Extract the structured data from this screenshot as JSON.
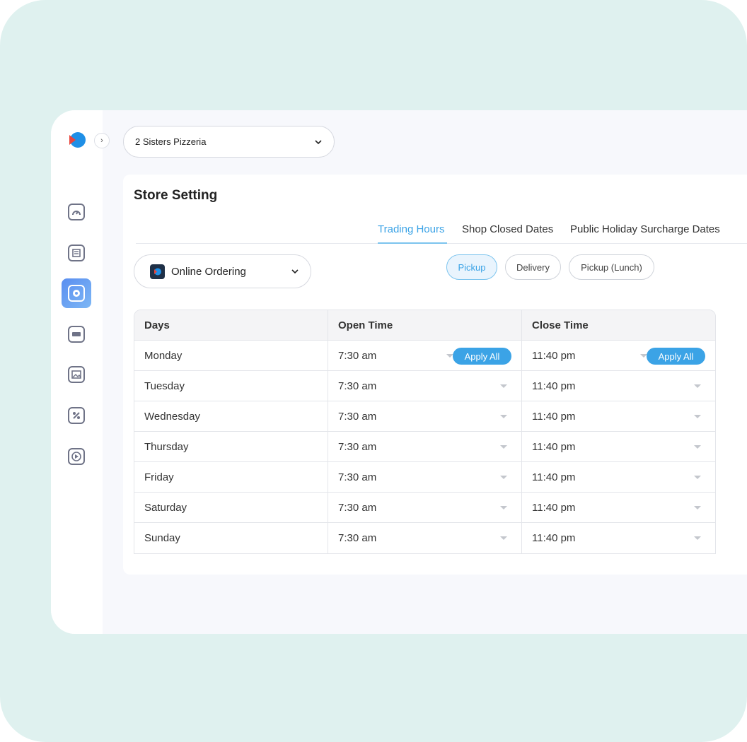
{
  "store_selector": {
    "value": "2 Sisters Pizzeria"
  },
  "page_title": "Store Setting",
  "tabs": [
    {
      "label": "Trading Hours",
      "active": true
    },
    {
      "label": "Shop Closed Dates",
      "active": false
    },
    {
      "label": "Public Holiday Surcharge Dates",
      "active": false
    }
  ],
  "channel_selector": {
    "value": "Online Ordering"
  },
  "order_types": [
    {
      "label": "Pickup",
      "active": true
    },
    {
      "label": "Delivery",
      "active": false
    },
    {
      "label": "Pickup (Lunch)",
      "active": false
    }
  ],
  "table": {
    "headers": [
      "Days",
      "Open Time",
      "Close Time"
    ],
    "apply_all_label": "Apply All",
    "rows": [
      {
        "day": "Monday",
        "open": "7:30 am",
        "close": "11:40 pm"
      },
      {
        "day": "Tuesday",
        "open": "7:30 am",
        "close": "11:40 pm"
      },
      {
        "day": "Wednesday",
        "open": "7:30 am",
        "close": "11:40 pm"
      },
      {
        "day": "Thursday",
        "open": "7:30 am",
        "close": "11:40 pm"
      },
      {
        "day": "Friday",
        "open": "7:30 am",
        "close": "11:40 pm"
      },
      {
        "day": "Saturday",
        "open": "7:30 am",
        "close": "11:40 pm"
      },
      {
        "day": "Sunday",
        "open": "7:30 am",
        "close": "11:40 pm"
      }
    ]
  },
  "sidebar": {
    "icons": [
      "dashboard-icon",
      "menu-icon",
      "settings-icon",
      "card-icon",
      "gallery-icon",
      "integrations-icon",
      "online-ordering-icon"
    ],
    "active_index": 2
  },
  "colors": {
    "accent": "#3ba3e6",
    "background": "#dff1ef",
    "active_nav": "#5a8ef0"
  }
}
